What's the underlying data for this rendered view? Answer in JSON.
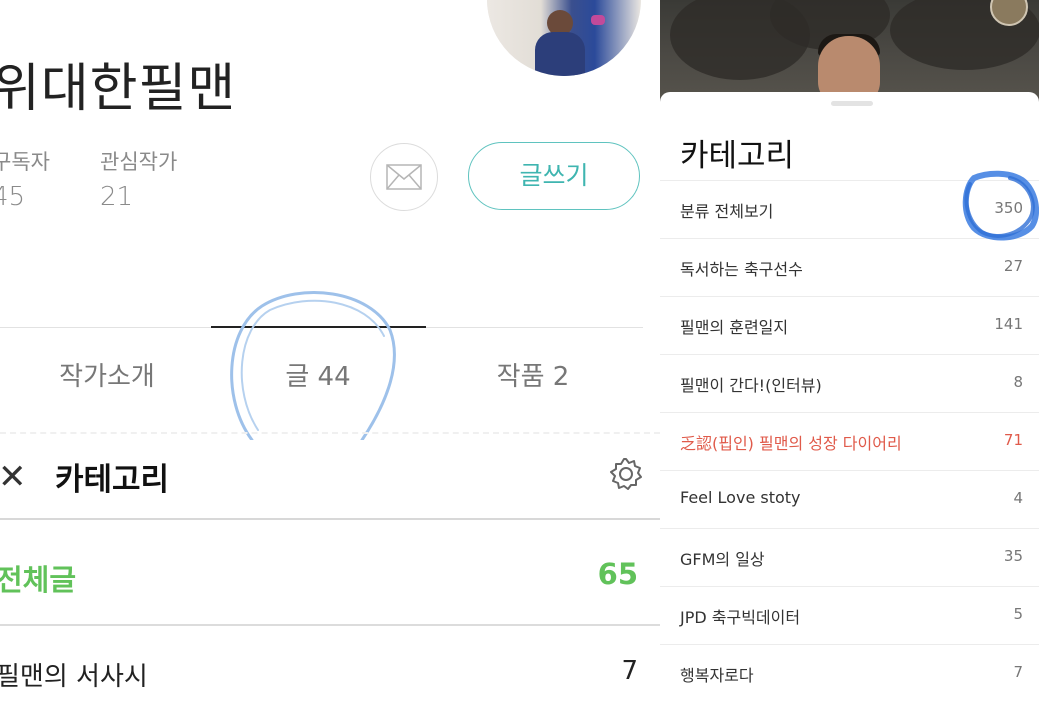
{
  "profile": {
    "writer_name": "위대한필맨",
    "subscribers_label": "구독자",
    "subscribers_value": "45",
    "following_label": "관심작가",
    "following_value": "21",
    "write_button": "글쓰기"
  },
  "tabs": [
    {
      "label": "작가소개"
    },
    {
      "label": "글 44"
    },
    {
      "label": "작품 2"
    }
  ],
  "category_panel": {
    "title": "카테고리",
    "all_label": "전체글",
    "all_count": "65",
    "items": [
      {
        "label": "필맨의 서사시",
        "count": "7"
      }
    ]
  },
  "category_sheet": {
    "title": "카테고리",
    "items": [
      {
        "label": "분류 전체보기",
        "count": "350"
      },
      {
        "label": "독서하는 축구선수",
        "count": "27"
      },
      {
        "label": "필맨의 훈련일지",
        "count": "141"
      },
      {
        "label": "필맨이 간다!(인터뷰)",
        "count": "8"
      },
      {
        "label": "乏認(핍인) 필맨의 성장 다이어리",
        "count": "71"
      },
      {
        "label": "Feel Love stoty",
        "count": "4"
      },
      {
        "label": "GFM의 일상",
        "count": "35"
      },
      {
        "label": "JPD 축구빅데이터",
        "count": "5"
      },
      {
        "label": "행복자로다",
        "count": "7"
      }
    ],
    "highlight_color": "#e05a4a"
  },
  "colors": {
    "accent_teal": "#3fb5b0",
    "accent_green": "#61c25a",
    "scribble_blue": "#3a7be0"
  }
}
